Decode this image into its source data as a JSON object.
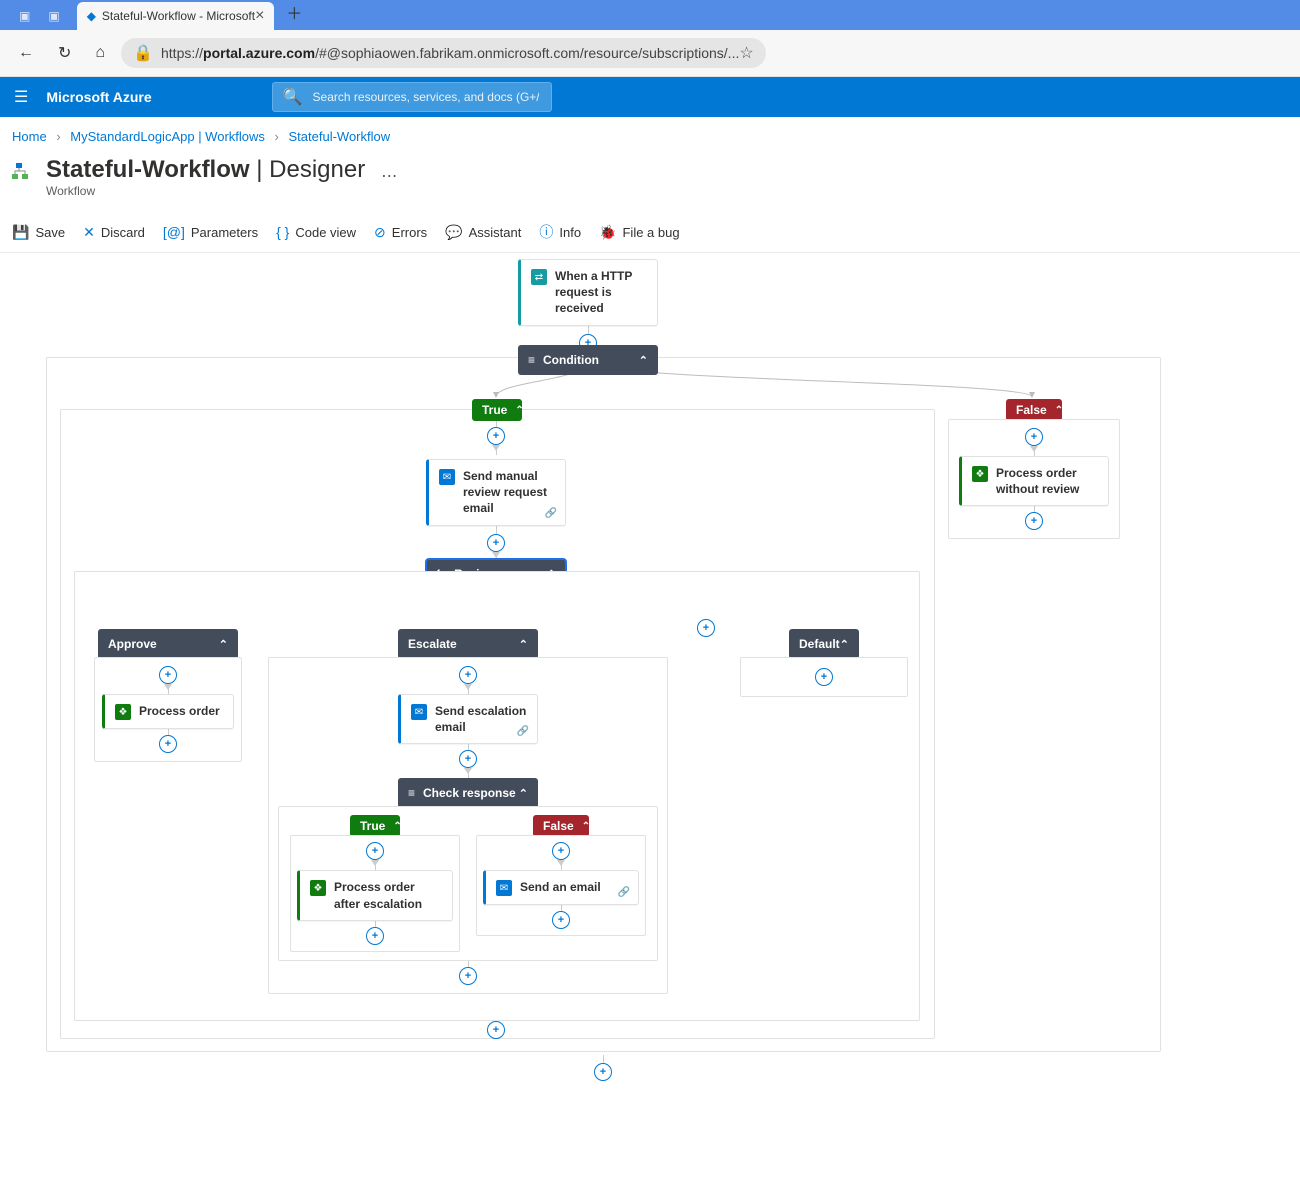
{
  "browser": {
    "tab_title": "Stateful-Workflow - Microsoft",
    "url_display_host": "portal.azure.com",
    "url_display_rest": "/#@sophiaowen.fabrikam.onmicrosoft.com/resource/subscriptions/..."
  },
  "azure": {
    "brand": "Microsoft Azure",
    "search_placeholder": "Search resources, services, and docs (G+/)"
  },
  "breadcrumbs": [
    "Home",
    "MyStandardLogicApp | Workflows",
    "Stateful-Workflow"
  ],
  "page": {
    "title_main": "Stateful-Workflow",
    "title_secondary": "Designer",
    "subtitle": "Workflow"
  },
  "toolbar": {
    "save": "Save",
    "discard": "Discard",
    "parameters": "Parameters",
    "codeview": "Code view",
    "errors": "Errors",
    "assistant": "Assistant",
    "info": "Info",
    "file_bug": "File a bug"
  },
  "workflow": {
    "trigger": "When a HTTP request is received",
    "condition": "Condition",
    "true": "True",
    "false": "False",
    "send_review": "Send manual review request email",
    "review": "Review",
    "approve": "Approve",
    "escalate": "Escalate",
    "default": "Default",
    "process_order": "Process order",
    "send_escalation": "Send escalation email",
    "check_response": "Check response",
    "process_after_escalation": "Process order after escalation",
    "send_email": "Send an email",
    "process_without_review": "Process order without review"
  }
}
